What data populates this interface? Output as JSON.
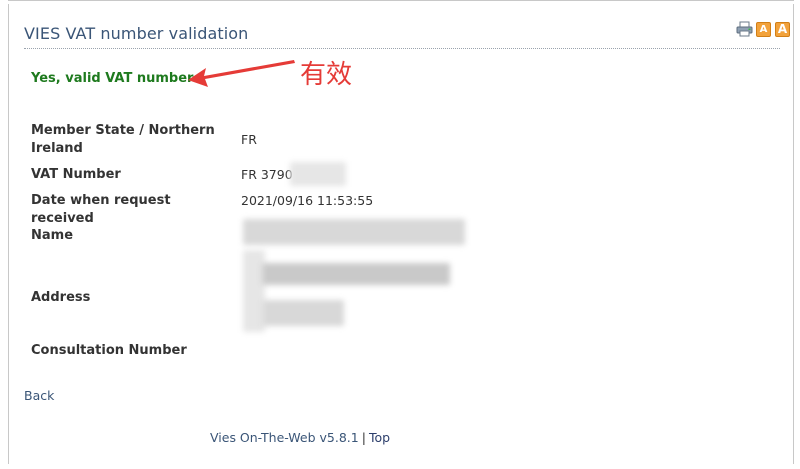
{
  "page": {
    "title": "VIES VAT number validation",
    "valid_message": "Yes, valid VAT number",
    "annotation": "有效"
  },
  "tools": {
    "print_icon": "printer-icon",
    "font_small": "A",
    "font_large": "A"
  },
  "fields": {
    "member_state_label": "Member State / Northern Ireland",
    "member_state_value": "FR",
    "vat_number_label": "VAT Number",
    "vat_number_value": "FR 3790",
    "date_label": "Date when request received",
    "date_value": "2021/09/16 11:53:55",
    "name_label": "Name",
    "address_label": "Address",
    "consultation_label": "Consultation Number"
  },
  "links": {
    "back": "Back"
  },
  "footer": {
    "version": "Vies On-The-Web v5.8.1",
    "separator": "|",
    "top": "Top"
  },
  "colors": {
    "title": "#3a5577",
    "valid": "#1e7a1e",
    "annotation": "#e53b37"
  }
}
